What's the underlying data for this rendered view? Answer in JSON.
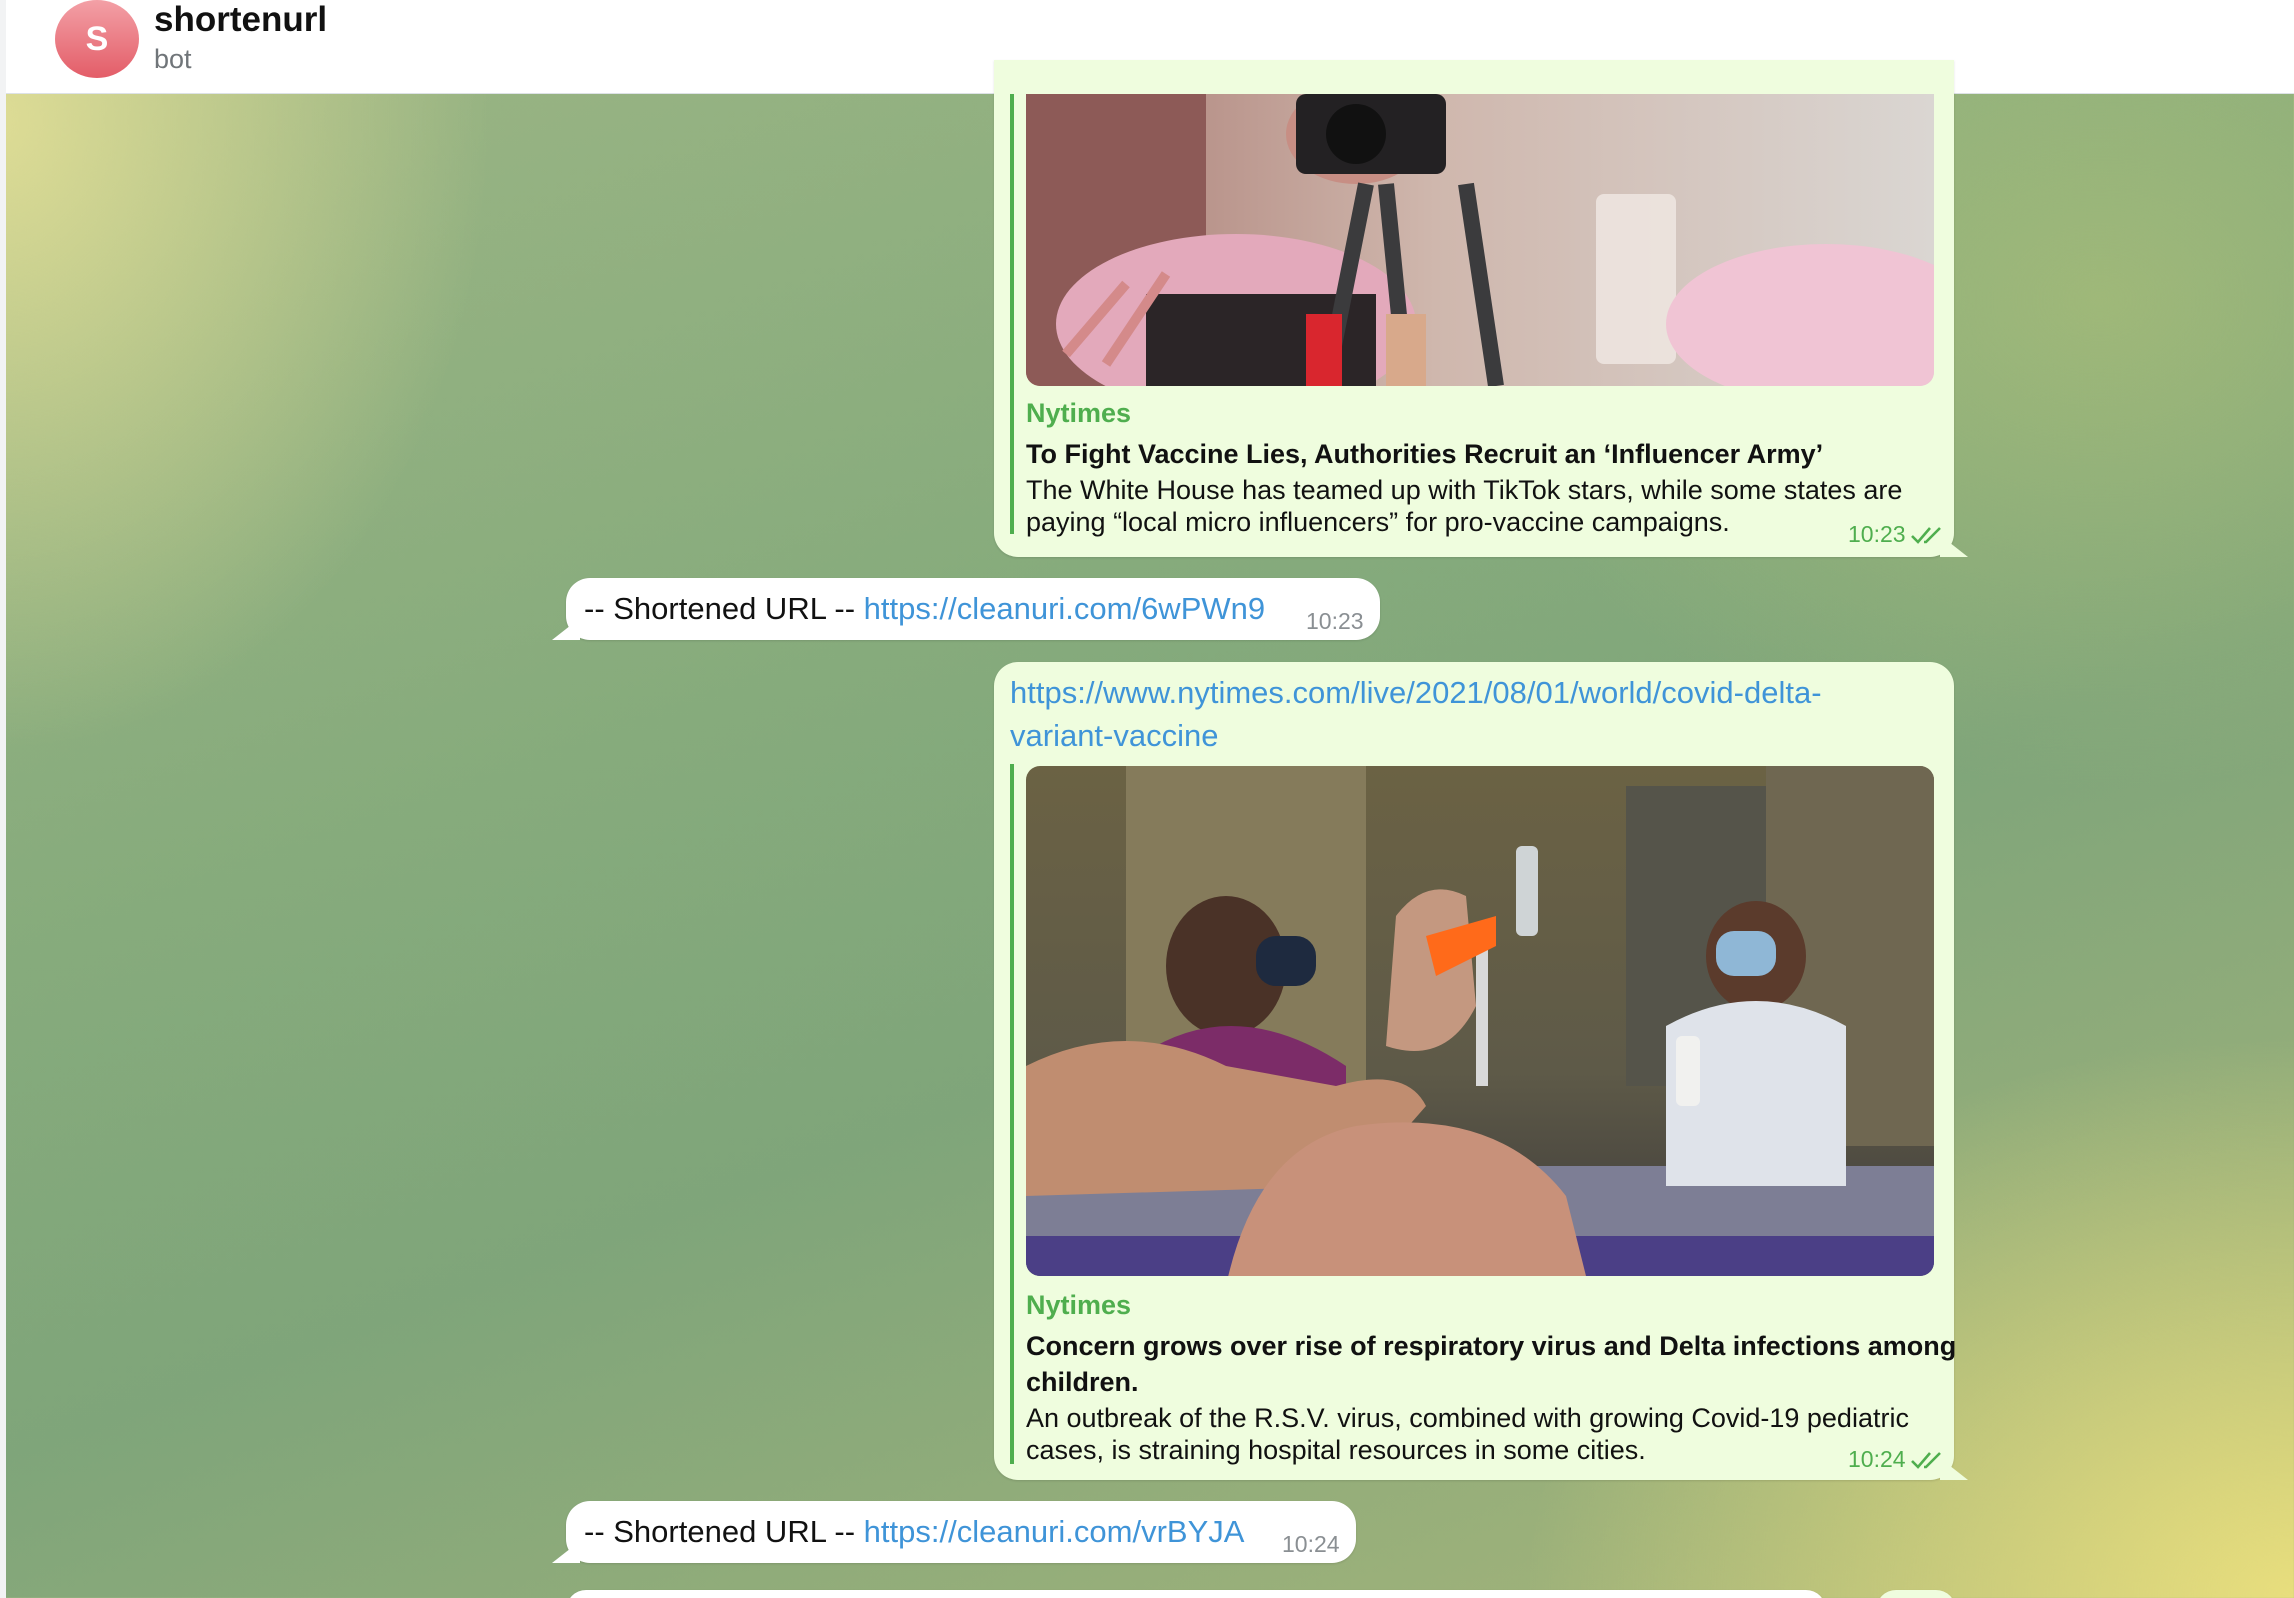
{
  "header": {
    "avatar_letter": "S",
    "title": "shortenurl",
    "status": "bot"
  },
  "messages": [
    {
      "direction": "out",
      "site": "Nytimes",
      "title": "To Fight Vaccine Lies, Authorities Recruit an ‘Influencer Army’",
      "desc_line1": "The White House has teamed up with TikTok stars, while some states are",
      "desc_line2": "paying “local micro influencers” for pro-vaccine campaigns.",
      "time": "10:23"
    },
    {
      "direction": "in",
      "prefix": "-- Shortened URL -- ",
      "link": "https://cleanuri.com/6wPWn9",
      "time": "10:23"
    },
    {
      "direction": "out",
      "url_line1": "https://www.nytimes.com/live/2021/08/01/world/covid-delta-",
      "url_line2": "variant-vaccine",
      "site": "Nytimes",
      "title_line1": "Concern grows over rise of respiratory virus and Delta infections among",
      "title_line2": "children.",
      "desc_line1": "An outbreak of the R.S.V. virus, combined with growing Covid-19 pediatric",
      "desc_line2": "cases, is straining hospital resources in some cities.",
      "time": "10:24"
    },
    {
      "direction": "in",
      "prefix": "-- Shortened URL -- ",
      "link": "https://cleanuri.com/vrBYJA",
      "time": "10:24"
    }
  ],
  "colors": {
    "outgoing_bubble": "#effdde",
    "incoming_bubble": "#ffffff",
    "link": "#3f94d8",
    "accent_green": "#4fae4e",
    "avatar": "#e35d68"
  }
}
